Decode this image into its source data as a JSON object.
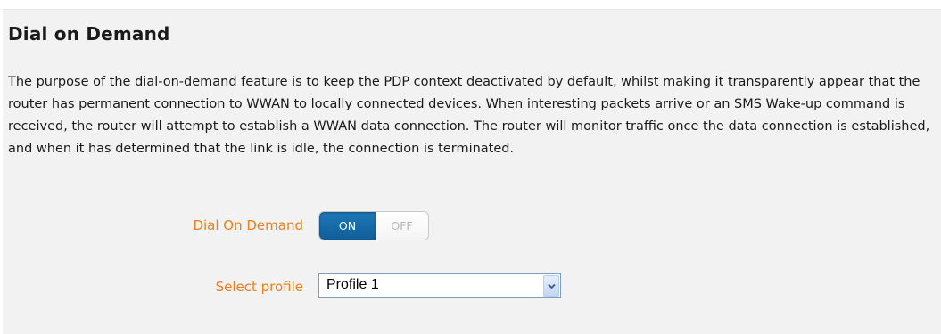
{
  "section": {
    "title": "Dial on Demand",
    "description": "The purpose of the dial-on-demand feature is to keep the PDP context deactivated by default, whilst making it transparently appear that the router has permanent connection to WWAN to locally connected devices. When interesting packets arrive or an SMS Wake-up command is received, the router will attempt to establish a WWAN data connection. The router will monitor traffic once the data connection is established, and when it has determined that the link is idle, the connection is terminated."
  },
  "dial_on_demand": {
    "label": "Dial On Demand",
    "on_label": "ON",
    "off_label": "OFF",
    "state": "ON"
  },
  "profile": {
    "label": "Select profile",
    "selected": "Profile 1"
  },
  "colors": {
    "label": "#f07e1b",
    "toggle_on": "#1a6aa8",
    "panel": "#f2f2f2"
  },
  "icons": {
    "dropdown": "chevron-down-icon"
  }
}
